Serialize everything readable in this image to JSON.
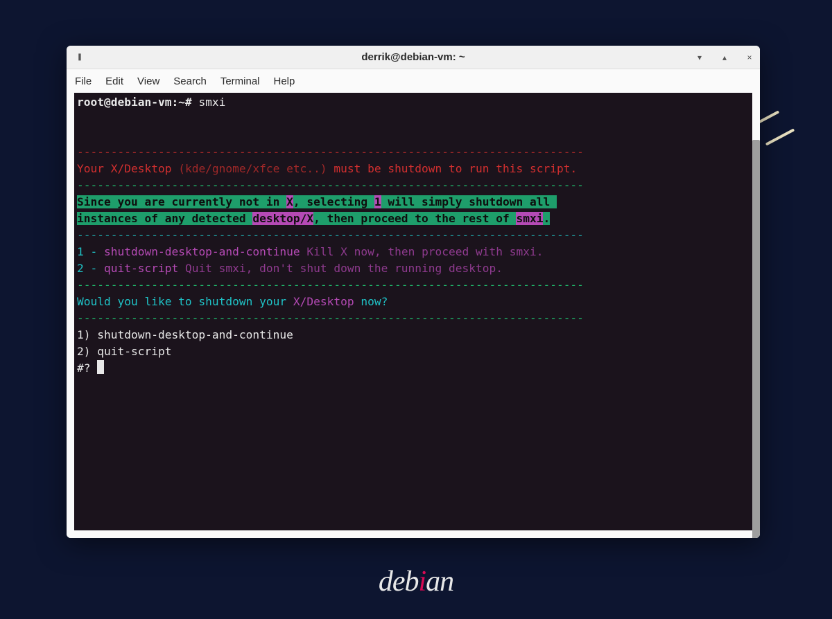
{
  "window": {
    "title": "derrik@debian-vm: ~"
  },
  "menu": {
    "file": "File",
    "edit": "Edit",
    "view": "View",
    "search": "Search",
    "terminal": "Terminal",
    "help": "Help"
  },
  "term": {
    "prompt": "root@debian-vm:~# ",
    "command": "smxi",
    "divider_red": "---------------------------------------------------------------------------",
    "msg1a": "Your ",
    "msg1b": "X/Desktop ",
    "msg1c": "(kde/gnome/xfce etc..)",
    "msg1d": " must be shutdown to run this script.",
    "divider_green": "---------------------------------------------------------------------------",
    "info1a": "Since you are currently not in ",
    "info1b": "X",
    "info1c": ", selecting ",
    "info1d": "1",
    "info1e": " will simply shutdown all ",
    "info2a": "instances of any detected ",
    "info2b": "desktop/X",
    "info2c": ", then proceed to the rest of ",
    "info2d": "smxi",
    "info2e": ".",
    "divider_cyan": "---------------------------------------------------------------------------",
    "opt1a": "1",
    "opt1b": " - ",
    "opt1c": "shutdown-desktop-and-continue",
    "opt1d": " Kill X now, then proceed with smxi.",
    "opt2a": "2",
    "opt2b": " - ",
    "opt2c": "quit-script",
    "opt2d": " Quit smxi, don't shut down the running desktop.",
    "q1a": "Would you like to shutdown your ",
    "q1b": "X/Desktop",
    "q1c": " now?",
    "sel1": "1) shutdown-desktop-and-continue",
    "sel2": "2) quit-script",
    "prompt2": "#? "
  },
  "logo": {
    "text_before": "deb",
    "dot": "i",
    "text_after": "an"
  }
}
